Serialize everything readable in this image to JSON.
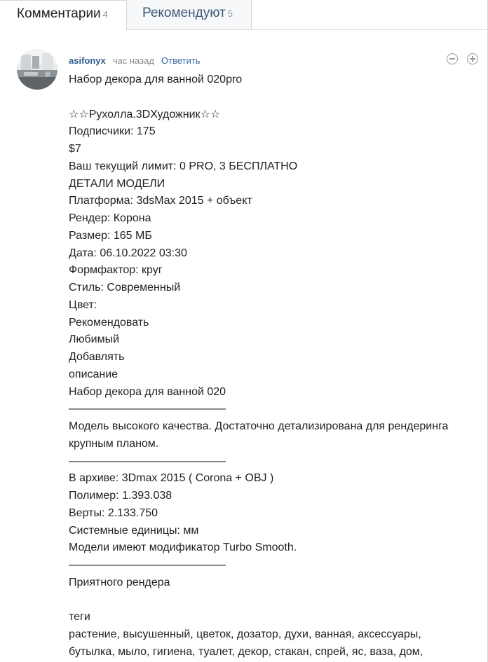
{
  "tabs": {
    "comments_label": "Комментарии",
    "comments_count": "4",
    "recommend_label": "Рекомендуют",
    "recommend_count": "5"
  },
  "comment": {
    "author": "asifonyx",
    "time": "час назад",
    "reply_label": "Ответить",
    "lines": {
      "l1": "Набор декора для ванной 020pro",
      "l2": "☆☆Рухолла.3DХудожник☆☆",
      "l3": "Подписчики: 175",
      "l4": "$7",
      "l5": "Ваш текущий лимит: 0 PRO, 3 БЕСПЛАТНО",
      "l6": "ДЕТАЛИ МОДЕЛИ",
      "l7": "Платформа: 3dsMax 2015 + объект",
      "l8": "Рендер: Корона",
      "l9": "Размер: 165 МБ",
      "l10": "Дата: 06.10.2022 03:30",
      "l11": "Формфактор: круг",
      "l12": "Стиль: Современный",
      "l13": "Цвет:",
      "l14": "Рекомендовать",
      "l15": "Любимый",
      "l16": "Добавлять",
      "l17": "описание",
      "l18": "Набор декора для ванной 020",
      "l19": "——————————————",
      "l20": "Модель высокого качества. Достаточно детализирована для рендеринга крупным планом.",
      "l21": "——————————————",
      "l22": "В архиве: 3Dmax 2015 ( Corona + OBJ )",
      "l23": "Полимер: 1.393.038",
      "l24": "Верты: 2.133.750",
      "l25": "Системные единицы: мм",
      "l26": "Модели имеют модификатор Turbo Smooth.",
      "l27": "——————————————",
      "l28": "Приятного рендера",
      "l29": "теги",
      "l30": "растение, высушенный, цветок, дозатор, духи, ванная, аксессуары,",
      "l31": "бутылка, мыло, гигиена, туалет, декор, стакан, спрей, яс, ваза, дом,"
    }
  }
}
